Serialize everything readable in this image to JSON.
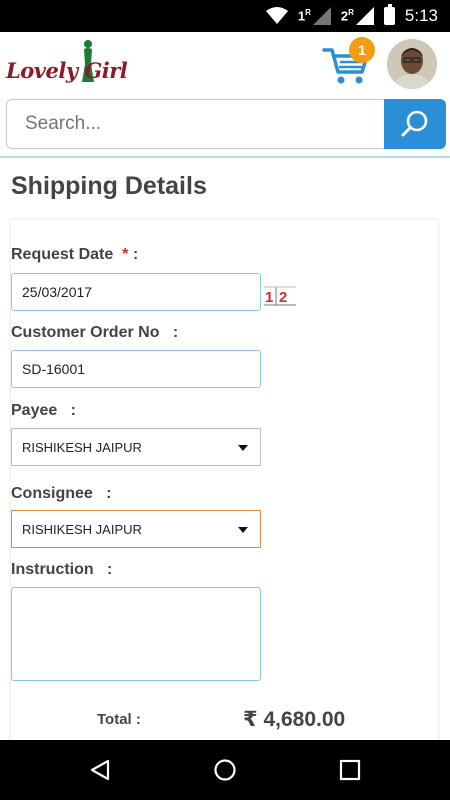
{
  "status_bar": {
    "sim1": "1",
    "sim1_sup": "R",
    "sim2": "2",
    "sim2_sup": "R",
    "time": "5:13"
  },
  "header": {
    "logo_text": "Lovely Girl",
    "cart_count": "1"
  },
  "search": {
    "placeholder": "Search..."
  },
  "page": {
    "title": "Shipping Details"
  },
  "form": {
    "request_date": {
      "label": "Request Date",
      "required_mark": "*",
      "colon": ":",
      "value": "25/03/2017"
    },
    "customer_order": {
      "label": "Customer Order No",
      "colon": ":",
      "value": "SD-16001"
    },
    "payee": {
      "label": "Payee",
      "colon": ":",
      "value": "RISHIKESH JAIPUR"
    },
    "consignee": {
      "label": "Consignee",
      "colon": ":",
      "value": "RISHIKESH JAIPUR"
    },
    "instruction": {
      "label": "Instruction",
      "colon": ":",
      "value": ""
    },
    "calendar_icon_text": "12"
  },
  "summary": {
    "total_label": "Total :",
    "total_value": "₹ 4,680.00"
  },
  "colors": {
    "accent_blue": "#2a8fd6",
    "badge_orange": "#f39c12",
    "logo_red": "#8b1a2b",
    "required_red": "#e8262a",
    "active_border": "#e08a3c"
  },
  "icons": {
    "search": "search-icon",
    "cart": "cart-icon",
    "back": "back-icon",
    "home": "home-icon",
    "recents": "recents-icon",
    "calendar": "calendar-icon"
  }
}
